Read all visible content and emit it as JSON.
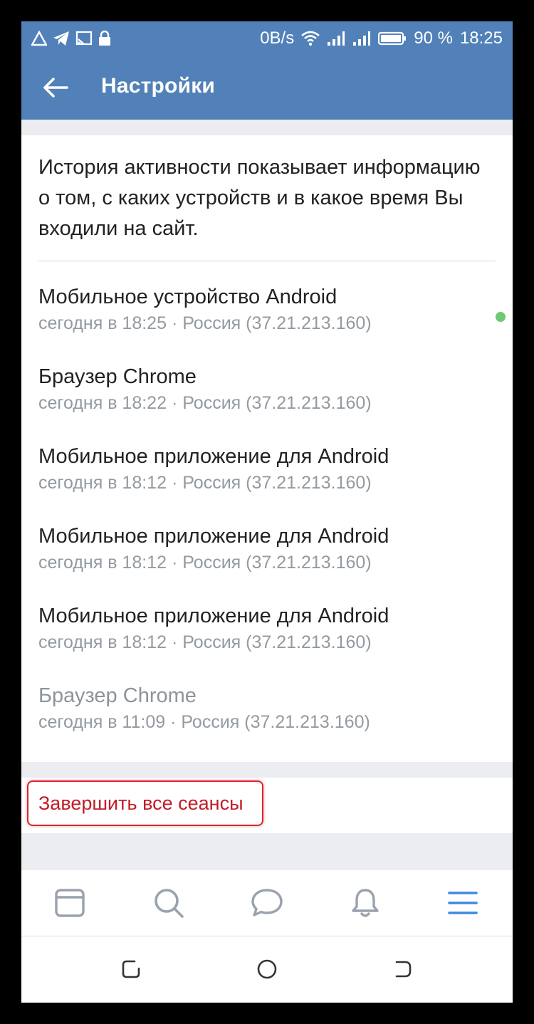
{
  "status_bar": {
    "network_speed": "0B/s",
    "battery": "90 %",
    "time": "18:25"
  },
  "app_bar": {
    "title": "Настройки"
  },
  "description": "История активности показывает информацию о том, с каких устройств и в какое время Вы входили на сайт.",
  "sessions": [
    {
      "title": "Мобильное устройство Android",
      "subtitle": "сегодня в 18:25 · Россия (37.21.213.160)",
      "online": true,
      "muted": false
    },
    {
      "title": "Браузер Chrome",
      "subtitle": "сегодня в 18:22 · Россия (37.21.213.160)",
      "online": false,
      "muted": false
    },
    {
      "title": "Мобильное приложение для Android",
      "subtitle": "сегодня в 18:12 · Россия (37.21.213.160)",
      "online": false,
      "muted": false
    },
    {
      "title": "Мобильное приложение для Android",
      "subtitle": "сегодня в 18:12 · Россия (37.21.213.160)",
      "online": false,
      "muted": false
    },
    {
      "title": "Мобильное приложение для Android",
      "subtitle": "сегодня в 18:12 · Россия (37.21.213.160)",
      "online": false,
      "muted": false
    },
    {
      "title": "Браузер Chrome",
      "subtitle": "сегодня в 11:09 · Россия (37.21.213.160)",
      "online": false,
      "muted": true
    }
  ],
  "end_sessions_label": "Завершить все сеансы",
  "tabs": [
    "news-icon",
    "search-icon",
    "messages-icon",
    "notifications-icon",
    "menu-icon"
  ],
  "colors": {
    "header": "#5181b8",
    "online": "#6fc873",
    "danger": "#c21b26",
    "active_tab": "#3f8ae0",
    "inactive_tab": "#99a2ad"
  }
}
